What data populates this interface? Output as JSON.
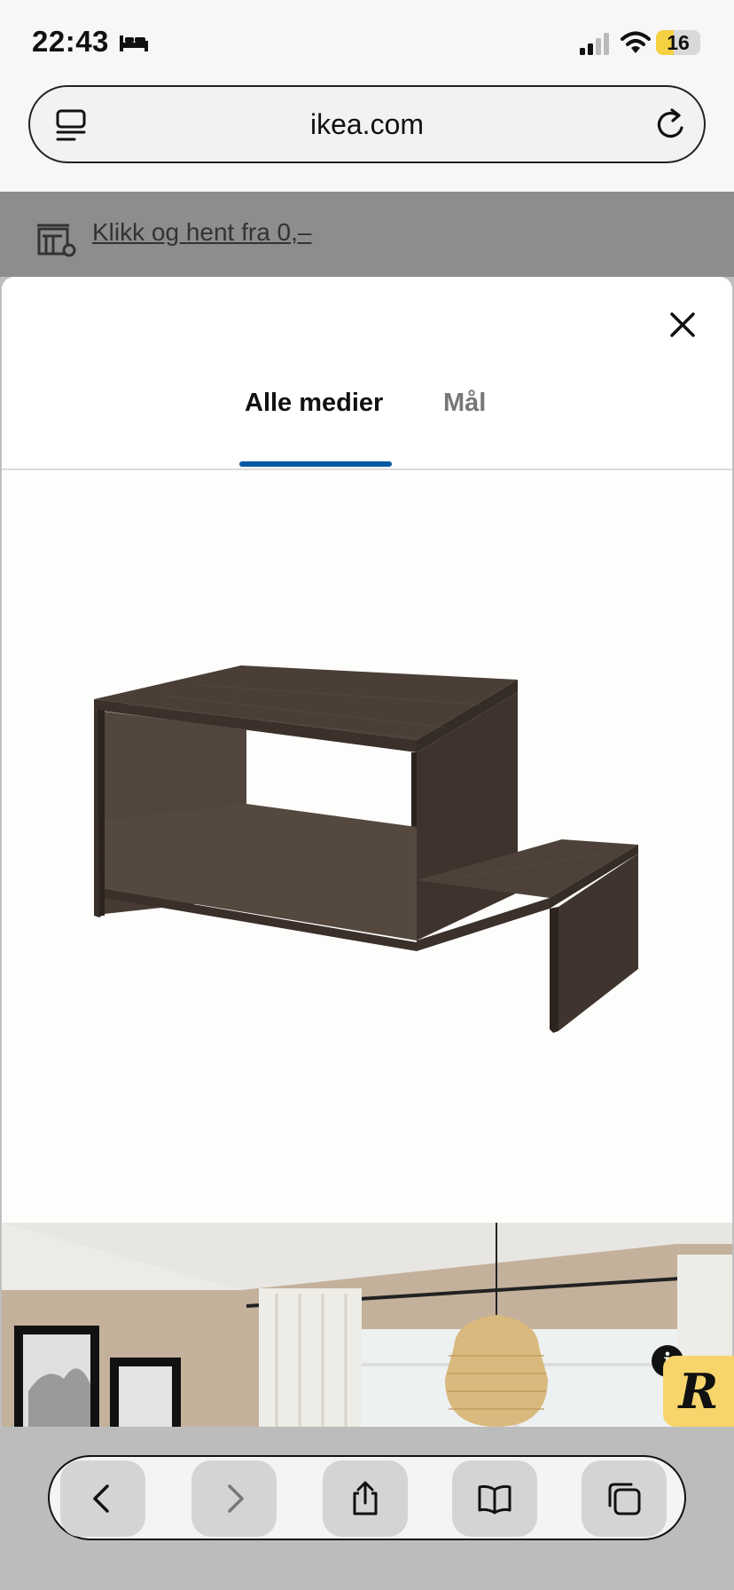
{
  "status_bar": {
    "time": "22:43",
    "battery_level": "16",
    "icons": [
      "bed-icon",
      "signal-icon",
      "wifi-icon",
      "battery-icon"
    ]
  },
  "url_bar": {
    "url": "ikea.com",
    "icons": [
      "tabs-icon",
      "reload-icon"
    ]
  },
  "page": {
    "promo_link": "Klikk og hent fra 0,–"
  },
  "modal": {
    "tabs": [
      {
        "label": "Alle medier",
        "active": true
      },
      {
        "label": "Mål",
        "active": false
      }
    ],
    "accent_color": "#0058a3",
    "images": [
      "product-image-coffee-table",
      "room-image-living-room"
    ]
  },
  "badges": {
    "info": "i",
    "r_logo": "R"
  },
  "toolbar": {
    "buttons": [
      "back",
      "forward",
      "share",
      "bookmarks",
      "tabs"
    ]
  }
}
